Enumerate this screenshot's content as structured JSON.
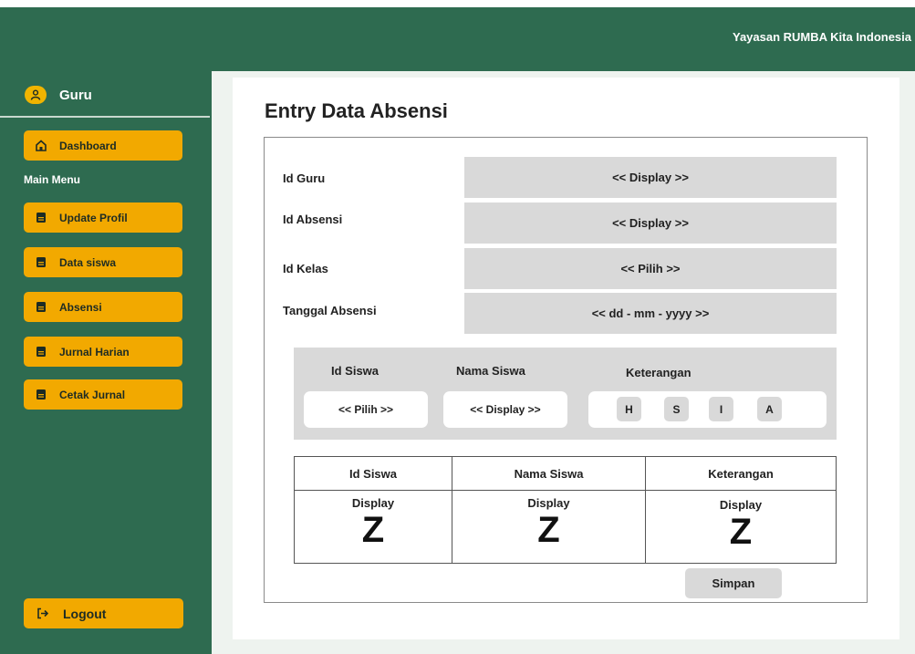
{
  "header": {
    "org_name": "Yayasan RUMBA Kita Indonesia"
  },
  "sidebar": {
    "user": {
      "label": "Guru",
      "icon": "user-icon"
    },
    "dashboard": {
      "label": "Dashboard",
      "icon": "home-icon"
    },
    "section_label": "Main Menu",
    "items": [
      {
        "label": "Update Profil",
        "icon": "document-icon"
      },
      {
        "label": "Data siswa",
        "icon": "document-icon"
      },
      {
        "label": "Absensi",
        "icon": "document-icon"
      },
      {
        "label": "Jurnal Harian",
        "icon": "document-icon"
      },
      {
        "label": "Cetak Jurnal",
        "icon": "document-icon"
      }
    ],
    "logout": {
      "label": "Logout",
      "icon": "logout-icon"
    }
  },
  "page": {
    "title": "Entry Data Absensi"
  },
  "form": {
    "fields": [
      {
        "label": "Id Guru",
        "value": "<< Display >>"
      },
      {
        "label": "Id Absensi",
        "value": "<< Display >>"
      },
      {
        "label": "Id Kelas",
        "value": "<< Pilih >>"
      },
      {
        "label": "Tanggal Absensi",
        "value": "<< dd - mm - yyyy >>"
      }
    ]
  },
  "entry": {
    "headers": {
      "id_siswa": "Id Siswa",
      "nama_siswa": "Nama Siswa",
      "keterangan": "Keterangan"
    },
    "id_siswa_value": "<< Pilih >>",
    "nama_siswa_value": "<< Display >>",
    "keterangan_options": [
      "H",
      "S",
      "I",
      "A"
    ]
  },
  "table": {
    "columns": [
      "Id Siswa",
      "Nama Siswa",
      "Keterangan"
    ],
    "row": [
      {
        "display": "Display",
        "mark": "Z"
      },
      {
        "display": "Display",
        "mark": "Z"
      },
      {
        "display": "Display",
        "mark": "Z"
      }
    ]
  },
  "actions": {
    "save_label": "Simpan"
  },
  "colors": {
    "sidebar_bg": "#2e6b50",
    "accent": "#f2a900",
    "field_bg": "#d9d9d9"
  }
}
